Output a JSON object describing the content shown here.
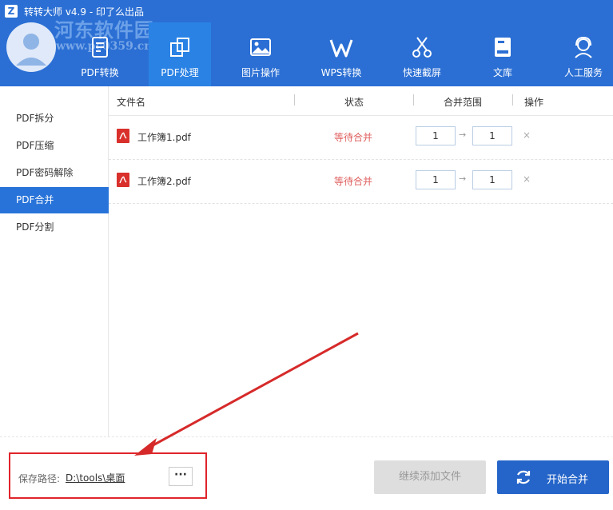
{
  "app": {
    "title": "转转大师 v4.9 - 印了么出品",
    "logo_letter": "Z"
  },
  "watermark": {
    "line1": "河东软件园",
    "line2": "www.pc0359.cn"
  },
  "nav": {
    "items": [
      {
        "label": "PDF转换",
        "icon": "pdf-convert-icon"
      },
      {
        "label": "PDF处理",
        "icon": "pdf-process-icon",
        "active": true
      },
      {
        "label": "图片操作",
        "icon": "image-icon"
      },
      {
        "label": "WPS转换",
        "icon": "wps-icon"
      },
      {
        "label": "快速截屏",
        "icon": "scissors-icon"
      },
      {
        "label": "文库",
        "icon": "library-icon"
      },
      {
        "label": "人工服务",
        "icon": "headset-icon"
      }
    ]
  },
  "sidebar": {
    "items": [
      {
        "label": "PDF拆分"
      },
      {
        "label": "PDF压缩"
      },
      {
        "label": "PDF密码解除"
      },
      {
        "label": "PDF合并",
        "active": true
      },
      {
        "label": "PDF分割"
      }
    ]
  },
  "table": {
    "headers": {
      "name": "文件名",
      "status": "状态",
      "range": "合并范围",
      "action": "操作"
    },
    "rows": [
      {
        "name": "工作簿1.pdf",
        "status": "等待合并",
        "from": "1",
        "to": "1"
      },
      {
        "name": "工作簿2.pdf",
        "status": "等待合并",
        "from": "1",
        "to": "1"
      }
    ],
    "range_arrow": "→",
    "delete_glyph": "×"
  },
  "footer": {
    "save_label": "保存路径:",
    "save_path": "D:\\tools\\桌面",
    "browse_label": "···",
    "add_files_label": "继续添加文件",
    "start_label": "开始合并"
  },
  "colors": {
    "header": "#2b6fd4",
    "active_nav": "#2a82e4",
    "active_side": "#2873d9",
    "status": "#e06060",
    "highlight": "#e0242b",
    "primary_button": "#2565c9"
  }
}
